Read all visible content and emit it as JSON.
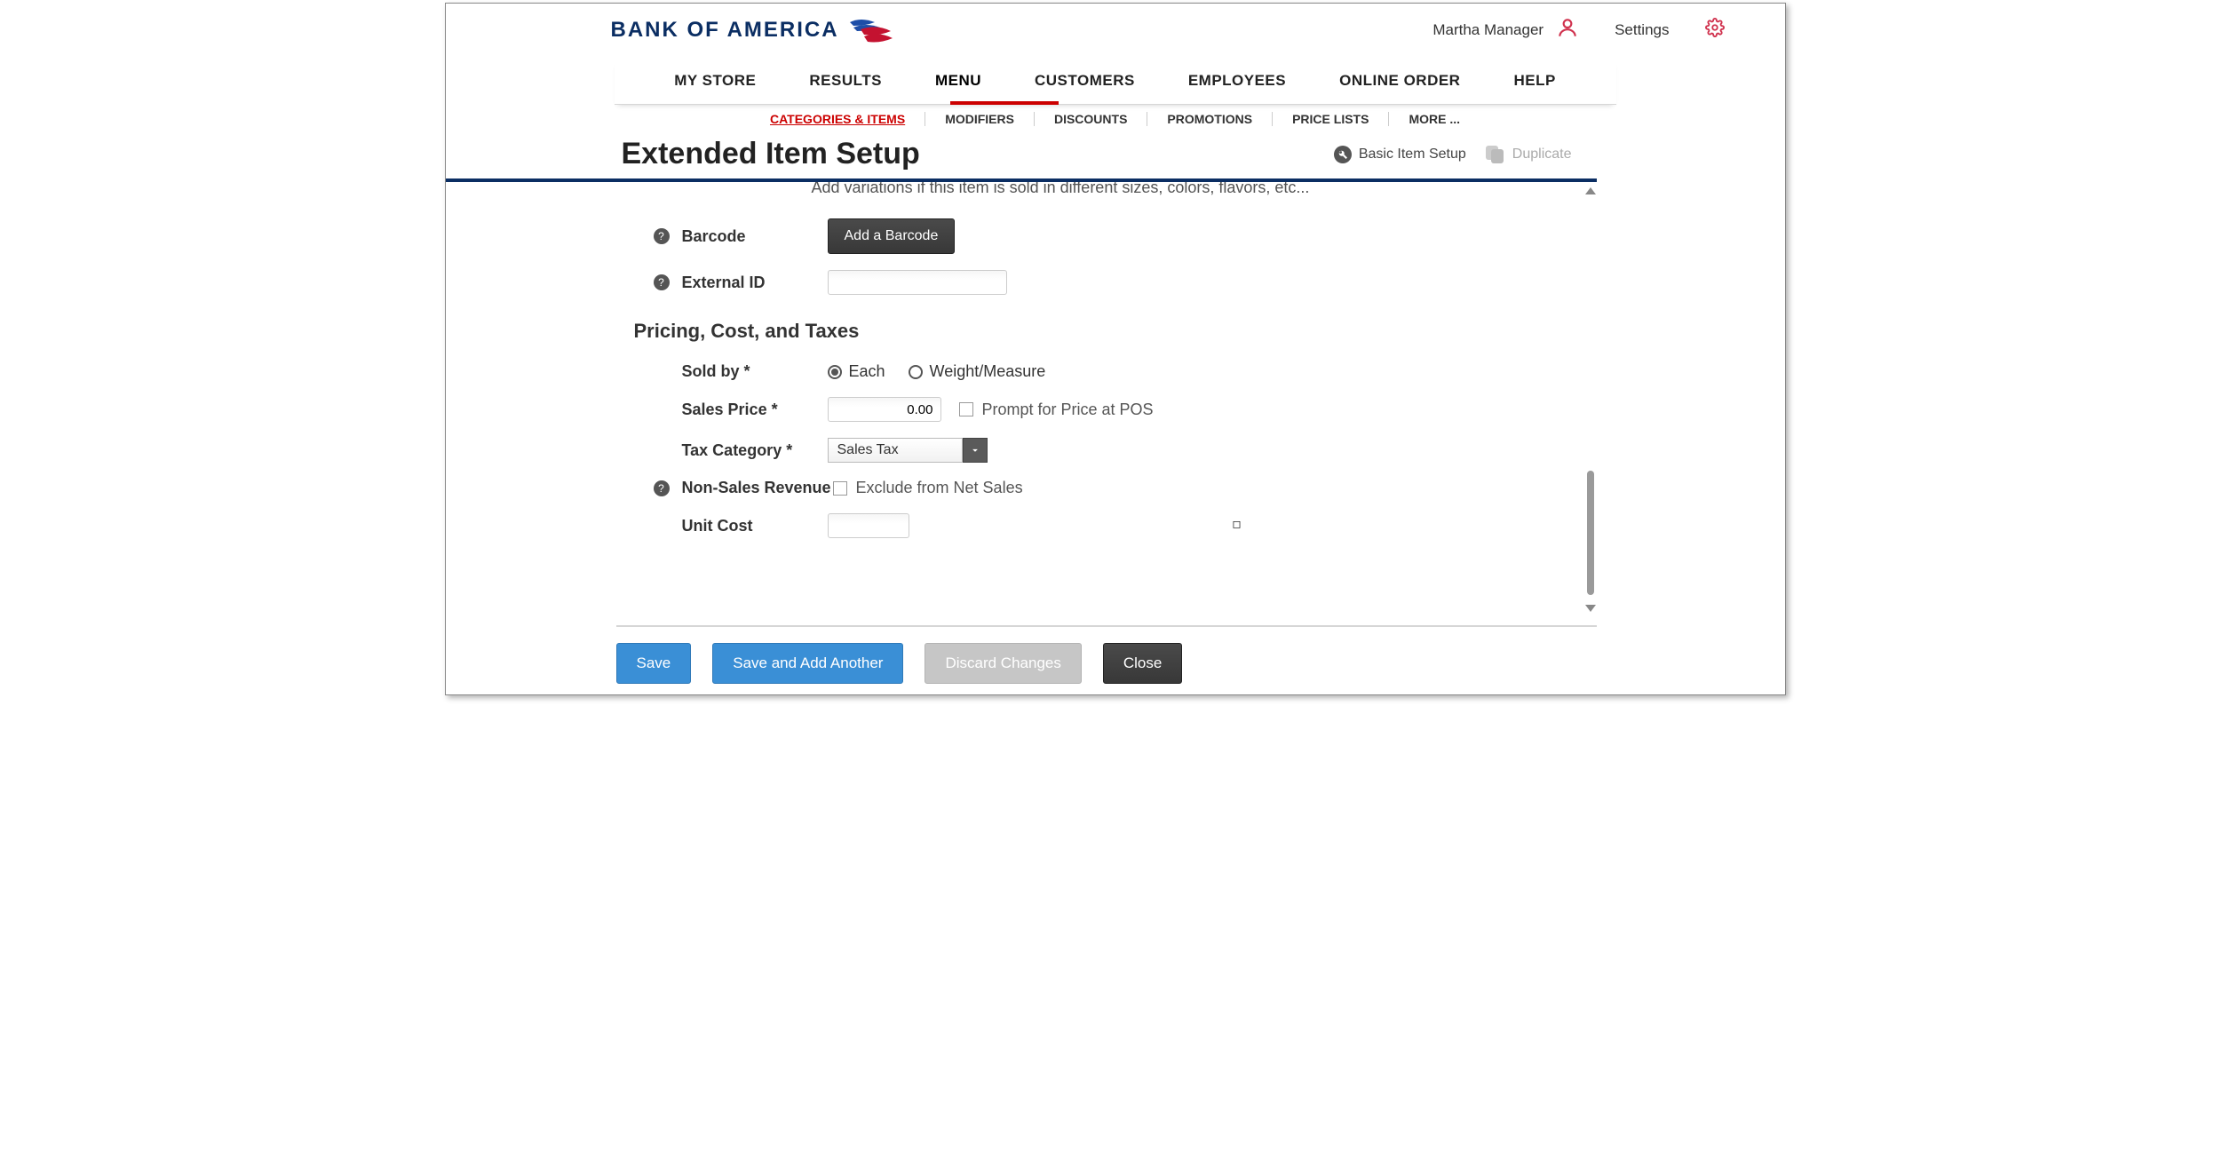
{
  "header": {
    "logo_text": "BANK OF AMERICA",
    "user_name": "Martha Manager",
    "settings_label": "Settings"
  },
  "main_nav": {
    "tabs": [
      "MY STORE",
      "RESULTS",
      "MENU",
      "CUSTOMERS",
      "EMPLOYEES",
      "ONLINE ORDER",
      "HELP"
    ],
    "active_index": 2
  },
  "sub_nav": {
    "tabs": [
      "CATEGORIES & ITEMS",
      "MODIFIERS",
      "DISCOUNTS",
      "PROMOTIONS",
      "PRICE LISTS"
    ],
    "more_label": "MORE ...",
    "active_index": 0
  },
  "page": {
    "title": "Extended Item Setup",
    "basic_setup_label": "Basic Item Setup",
    "duplicate_label": "Duplicate"
  },
  "form": {
    "variations_hint": "Add variations if this item is sold in different sizes, colors, flavors, etc...",
    "barcode_label": "Barcode",
    "add_barcode_button": "Add a Barcode",
    "external_id_label": "External ID",
    "external_id_value": "",
    "section_pricing_heading": "Pricing, Cost, and Taxes",
    "sold_by_label": "Sold by *",
    "sold_by_each": "Each",
    "sold_by_weight": "Weight/Measure",
    "sold_by_selected": "each",
    "sales_price_label": "Sales Price *",
    "sales_price_value": "0.00",
    "prompt_price_label": "Prompt for Price at POS",
    "prompt_price_checked": false,
    "tax_category_label": "Tax Category *",
    "tax_category_value": "Sales Tax",
    "non_sales_label": "Non-Sales Revenue",
    "exclude_net_label": "Exclude from Net Sales",
    "exclude_net_checked": false,
    "unit_cost_label": "Unit Cost",
    "unit_cost_value": ""
  },
  "buttons": {
    "save": "Save",
    "save_add_another": "Save and Add Another",
    "discard": "Discard Changes",
    "close": "Close"
  },
  "colors": {
    "brand_navy": "#0b2e63",
    "brand_red": "#c00",
    "accent_pink": "#d0324e",
    "primary_button": "#3a8fd6"
  }
}
